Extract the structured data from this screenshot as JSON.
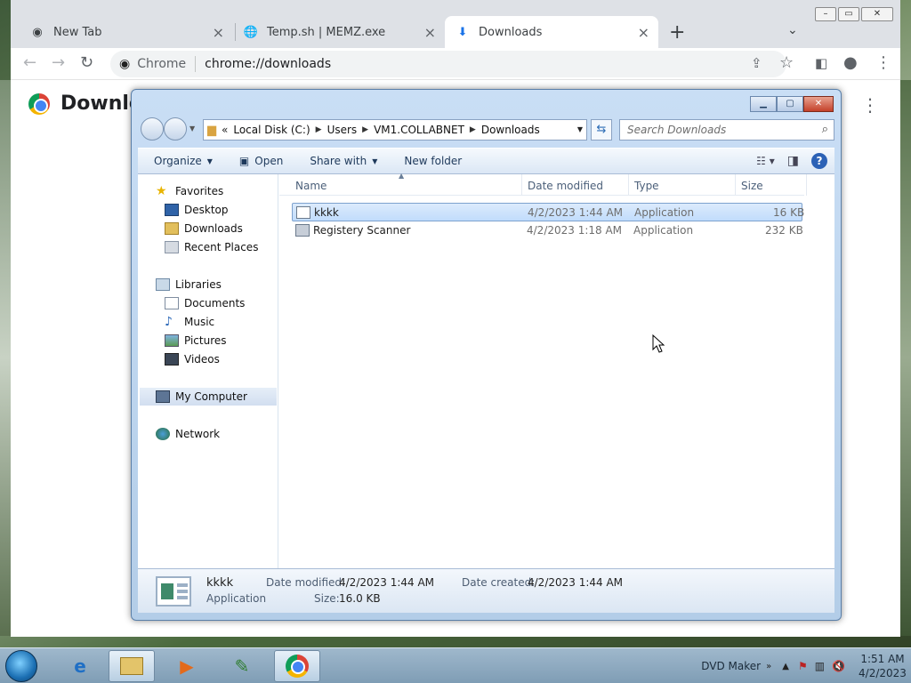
{
  "chrome": {
    "tabs": [
      {
        "title": "New Tab"
      },
      {
        "title": "Temp.sh | MEMZ.exe"
      },
      {
        "title": "Downloads"
      }
    ],
    "omnibox": {
      "site": "Chrome",
      "url": "chrome://downloads"
    },
    "page_title": "Downloads"
  },
  "explorer": {
    "breadcrumb": [
      "Local Disk (C:)",
      "Users",
      "VM1.COLLABNET",
      "Downloads"
    ],
    "search_placeholder": "Search Downloads",
    "commands": {
      "organize": "Organize",
      "open": "Open",
      "share_with": "Share with",
      "new_folder": "New folder"
    },
    "nav": {
      "favorites": "Favorites",
      "desktop": "Desktop",
      "downloads": "Downloads",
      "recent_places": "Recent Places",
      "libraries": "Libraries",
      "documents": "Documents",
      "music": "Music",
      "pictures": "Pictures",
      "videos": "Videos",
      "my_computer": "My Computer",
      "network": "Network"
    },
    "columns": {
      "name": "Name",
      "date_modified": "Date modified",
      "type": "Type",
      "size": "Size"
    },
    "files": [
      {
        "name": "kkkk",
        "date": "4/2/2023 1:44 AM",
        "type": "Application",
        "size": "16 KB"
      },
      {
        "name": "Registery Scanner",
        "date": "4/2/2023 1:18 AM",
        "type": "Application",
        "size": "232 KB"
      }
    ],
    "details": {
      "name": "kkkk",
      "type": "Application",
      "date_modified_label": "Date modified:",
      "date_modified": "4/2/2023 1:44 AM",
      "date_created_label": "Date created:",
      "date_created": "4/2/2023 1:44 AM",
      "size_label": "Size:",
      "size": "16.0 KB"
    }
  },
  "taskbar": {
    "tray_label": "DVD Maker",
    "time": "1:51 AM",
    "date": "4/2/2023"
  }
}
